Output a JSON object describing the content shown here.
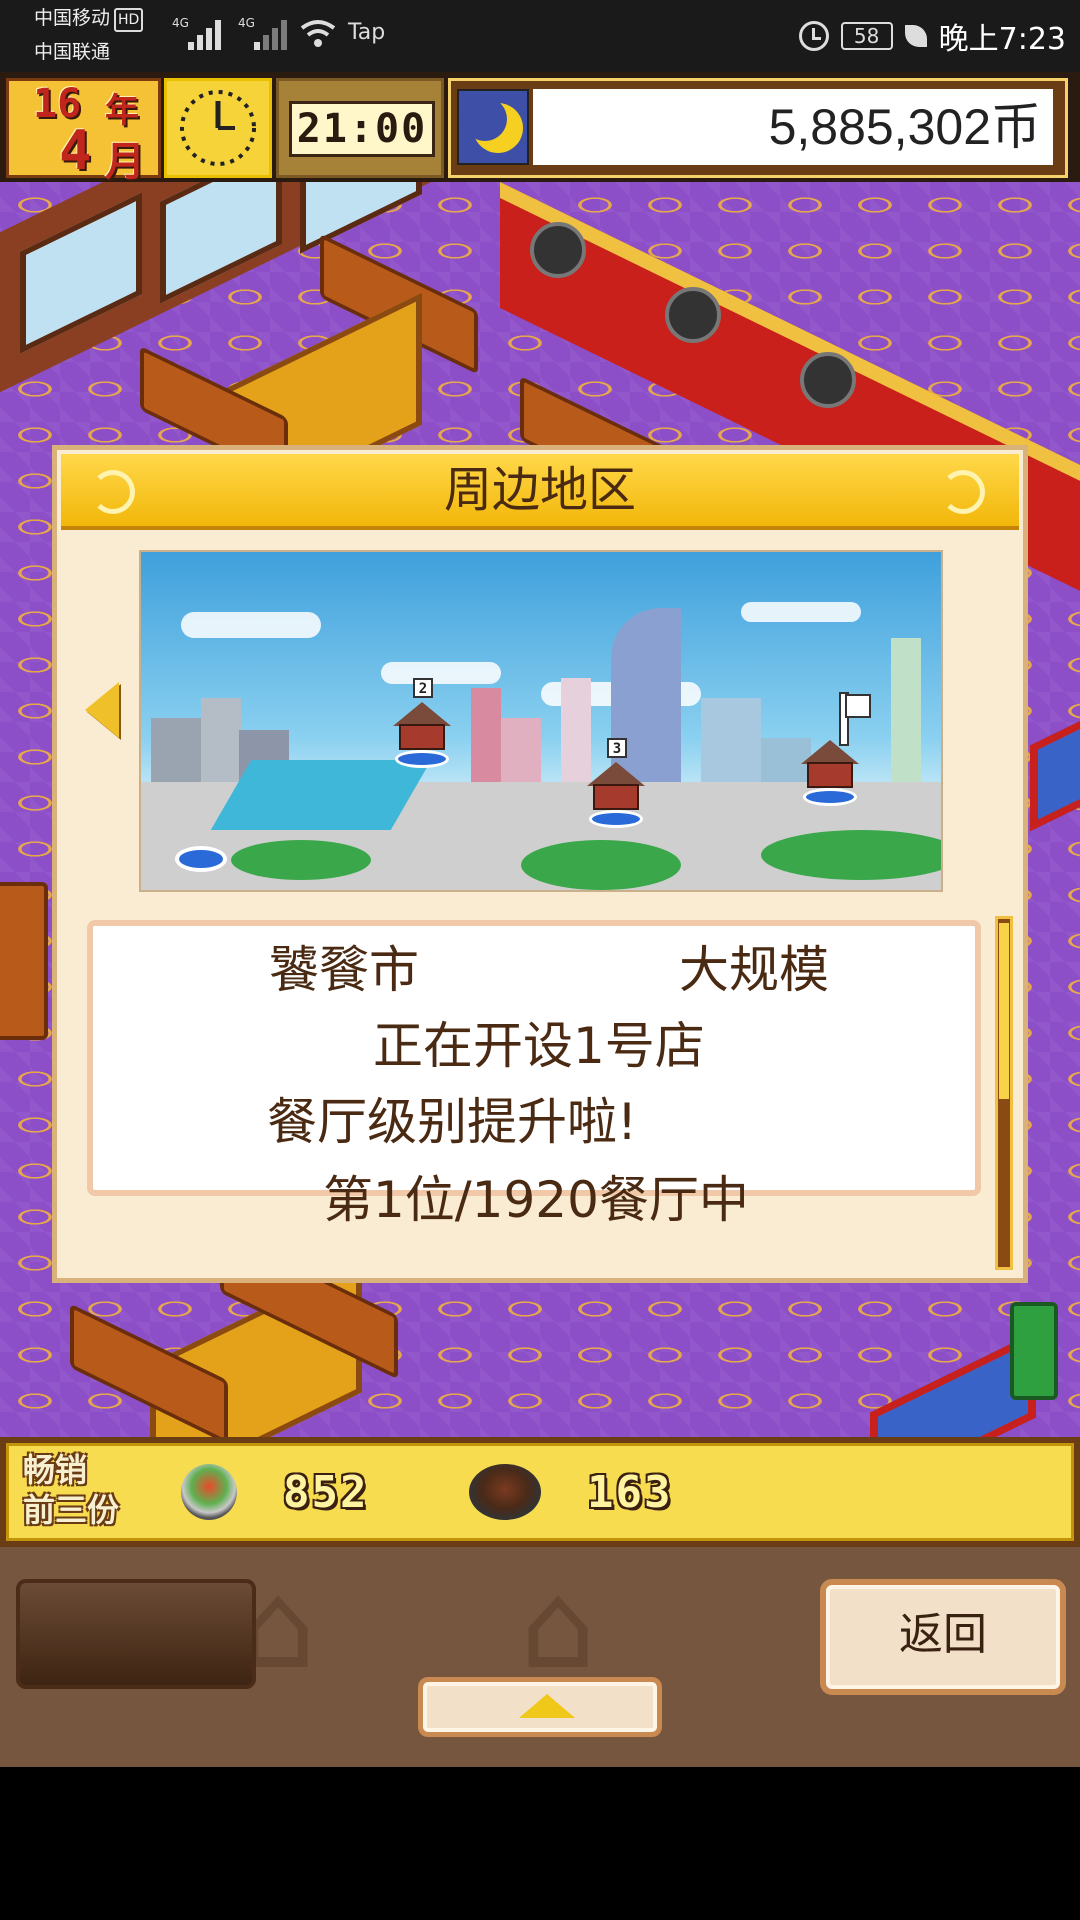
{
  "status_bar": {
    "carrier_1": "中国移动",
    "hd": "HD",
    "carrier_2": "中国联通",
    "signal_1": "4G",
    "signal_2": "4G",
    "tap_label": "Tap",
    "battery": "58",
    "time": "晚上7:23"
  },
  "hud": {
    "year": "16",
    "year_unit": "年",
    "month": "4",
    "month_unit": "月",
    "game_time": "21:00",
    "money": "5,885,302币"
  },
  "modal": {
    "title": "周边地区",
    "map_markers": [
      "2",
      "3"
    ],
    "info": {
      "city": "饕餮市",
      "scale": "大规模",
      "opening": "正在开设1号店",
      "level_up": "餐厅级别提升啦!",
      "ranking": "第1位/1920餐厅中"
    }
  },
  "sales": {
    "label_line1": "畅销",
    "label_line2": "前三份",
    "items": [
      {
        "icon": "salad-bowl-icon",
        "count": "852"
      },
      {
        "icon": "grill-dish-icon",
        "count": "163"
      }
    ]
  },
  "controls": {
    "back_label": "返回"
  },
  "colors": {
    "gold": "#f7dc50",
    "brown": "#6b3d14",
    "floor_purple": "#8c4fc8",
    "text_brown": "#4a2a12"
  }
}
